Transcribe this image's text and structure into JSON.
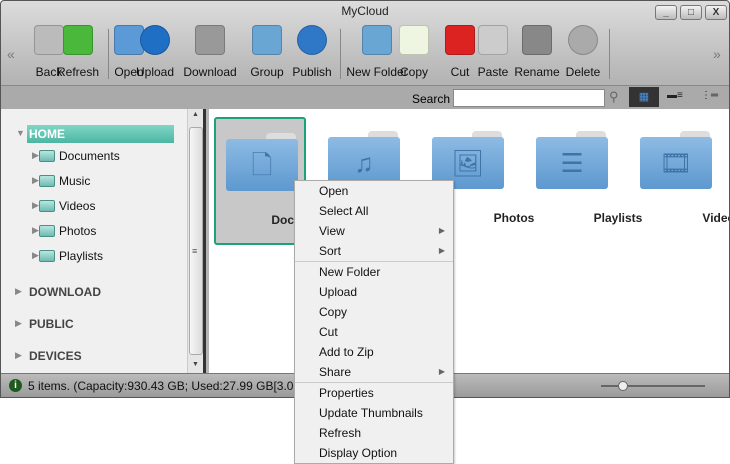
{
  "window": {
    "title": "MyCloud",
    "minimize": "_",
    "maximize": "□",
    "close": "X"
  },
  "toolbar": {
    "items": [
      {
        "label": "Back",
        "icon": "back-arrow-icon"
      },
      {
        "label": "Refresh",
        "icon": "refresh-icon"
      },
      {
        "label": "Open",
        "icon": "open-folder-icon"
      },
      {
        "label": "Upload",
        "icon": "upload-globe-icon"
      },
      {
        "label": "Download",
        "icon": "download-icon"
      },
      {
        "label": "Group",
        "icon": "group-folder-icon"
      },
      {
        "label": "Publish",
        "icon": "publish-icon"
      },
      {
        "label": "New Folder",
        "icon": "new-folder-icon"
      },
      {
        "label": "Copy",
        "icon": "copy-icon"
      },
      {
        "label": "Cut",
        "icon": "scissors-icon"
      },
      {
        "label": "Paste",
        "icon": "clipboard-icon"
      },
      {
        "label": "Rename",
        "icon": "rename-icon"
      },
      {
        "label": "Delete",
        "icon": "delete-icon"
      }
    ],
    "scroll_left": "«",
    "scroll_right": "»"
  },
  "search": {
    "label": "Search",
    "value": ""
  },
  "sidebar": {
    "home": "HOME",
    "children": [
      "Documents",
      "Music",
      "Videos",
      "Photos",
      "Playlists"
    ],
    "sections": [
      "DOWNLOAD",
      "PUBLIC",
      "DEVICES"
    ]
  },
  "main": {
    "items": [
      "Documents",
      "Music",
      "Photos",
      "Playlists",
      "Videos"
    ]
  },
  "status": {
    "text": "5 items. (Capacity:930.43 GB; Used:27.99 GB[3.0"
  },
  "context_menu": {
    "groups": [
      [
        "Open",
        "Select All",
        "View",
        "Sort"
      ],
      [
        "New Folder",
        "Upload",
        "Copy",
        "Cut",
        "Add to Zip",
        "Share"
      ],
      [
        "Properties",
        "Update Thumbnails",
        "Refresh",
        "Display Option"
      ]
    ],
    "submenu": [
      "View",
      "Sort",
      "Share"
    ]
  },
  "colors": {
    "accent": "#1aa37a",
    "home": "#5cc2ae",
    "folder": "#6ea6d8"
  }
}
